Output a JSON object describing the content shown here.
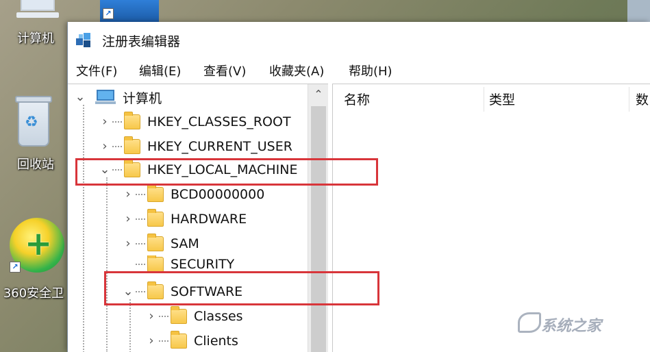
{
  "desktop": {
    "icons": [
      {
        "label": "计算机"
      },
      {
        "label": "回收站"
      },
      {
        "label": "360安全卫"
      }
    ]
  },
  "window": {
    "title": "注册表编辑器",
    "menu": [
      "文件(F)",
      "编辑(E)",
      "查看(V)",
      "收藏夹(A)",
      "帮助(H)"
    ]
  },
  "tree": {
    "root": "计算机",
    "items": [
      {
        "label": "HKEY_CLASSES_ROOT",
        "expander": "›"
      },
      {
        "label": "HKEY_CURRENT_USER",
        "expander": "›"
      },
      {
        "label": "HKEY_LOCAL_MACHINE",
        "expander": "⌄"
      },
      {
        "label": "BCD00000000",
        "expander": "›"
      },
      {
        "label": "HARDWARE",
        "expander": "›"
      },
      {
        "label": "SAM",
        "expander": "›"
      },
      {
        "label": "SECURITY",
        "expander": ""
      },
      {
        "label": "SOFTWARE",
        "expander": "⌄"
      },
      {
        "label": "Classes",
        "expander": "›"
      },
      {
        "label": "Clients",
        "expander": "›"
      }
    ]
  },
  "list": {
    "columns": [
      "名称",
      "类型",
      "数"
    ]
  },
  "watermark": "系统之家",
  "colors": {
    "highlight": "#d8353a",
    "folder": "#f7c84a"
  }
}
